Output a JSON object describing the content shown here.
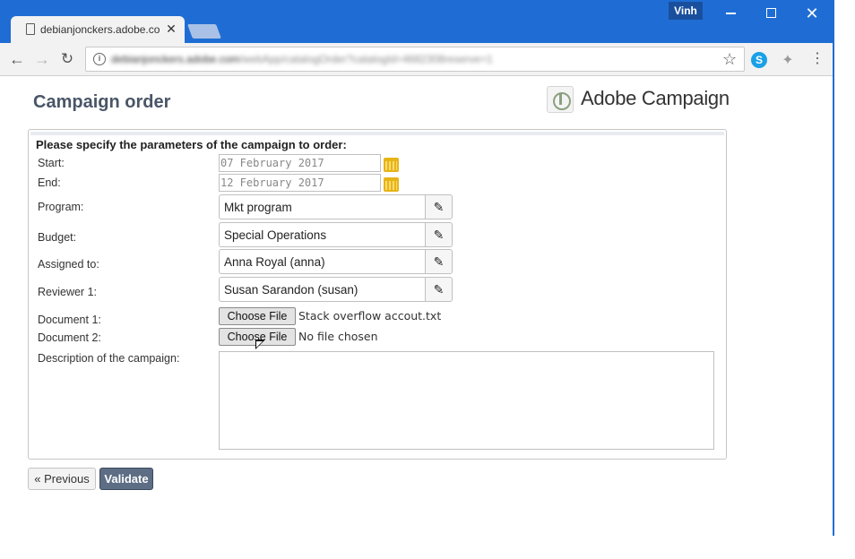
{
  "browser": {
    "tab_title": "debianjonckers.adobe.co",
    "tab_close": "✕",
    "user_name": "Vinh",
    "window_controls": {
      "minimize": "minimize-icon",
      "maximize": "maximize-icon",
      "close": "✕"
    },
    "nav": {
      "back": "←",
      "forward": "→",
      "reload": "↻"
    },
    "url_host": "debianjonckers.adobe.com",
    "url_path": "/webApp/catalogOrder?catalogId=4682308reserve=1",
    "bookmark_icon": "☆",
    "menu_icon": "⋮",
    "skype_label": "S"
  },
  "page": {
    "title": "Campaign order",
    "logo_text": "Adobe Campaign"
  },
  "form": {
    "intro": "Please specify the parameters of the campaign to order:",
    "start": {
      "label": "Start:",
      "value": "07 February 2017"
    },
    "end": {
      "label": "End:",
      "value": "12 February 2017"
    },
    "program": {
      "label": "Program:",
      "value": "Mkt program"
    },
    "budget": {
      "label": "Budget:",
      "value": "Special Operations"
    },
    "assigned_to": {
      "label": "Assigned to:",
      "value": "Anna Royal (anna)"
    },
    "reviewer1": {
      "label": "Reviewer 1:",
      "value": "Susan Sarandon (susan)"
    },
    "document1": {
      "label": "Document 1:",
      "button": "Choose File",
      "file": "Stack overflow accout.txt"
    },
    "document2": {
      "label": "Document 2:",
      "button": "Choose File",
      "file": "No file chosen"
    },
    "description": {
      "label": "Description of the campaign:",
      "value": ""
    },
    "edit_icon": "✎"
  },
  "actions": {
    "previous": "« Previous",
    "validate": "Validate"
  },
  "colors": {
    "titlebar": "#1f6dd4",
    "title_text": "#495667",
    "validate_bg": "#5d6d84",
    "calendar_icon": "#e7b417"
  }
}
